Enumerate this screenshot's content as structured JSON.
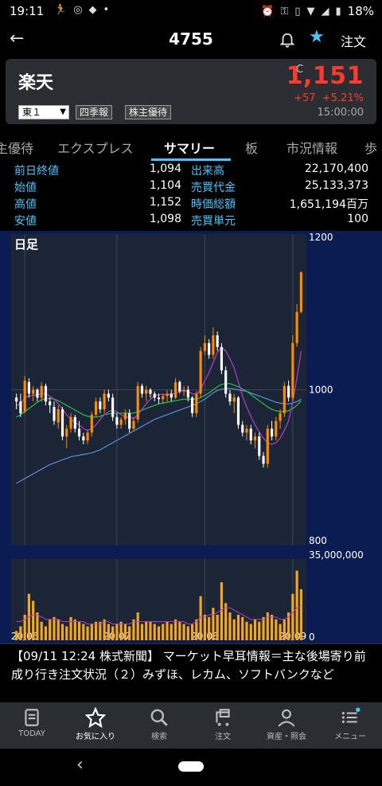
{
  "status_bar": {
    "time": "19:11",
    "battery": "18%"
  },
  "app_bar": {
    "title": "4755",
    "order_label": "注文"
  },
  "quote": {
    "name": "楽天",
    "market": "東１",
    "tag_quarterly": "四季報",
    "tag_benefit": "株主優待",
    "close_mark": "C",
    "price": "1,151",
    "change": "+57",
    "change_pct": "+5.21%",
    "time": "15:00:00"
  },
  "tabs": [
    "主優待",
    "エクスプレス",
    "サマリー",
    "板",
    "市況情報",
    "歩"
  ],
  "stats": [
    {
      "label": "前日終値",
      "value": "1,094",
      "label2": "出来高",
      "value2": "22,170,400"
    },
    {
      "label": "始値",
      "value": "1,104",
      "label2": "売買代金",
      "value2": "25,133,373"
    },
    {
      "label": "高値",
      "value": "1,152",
      "label2": "時価総額",
      "value2": "1,651,194百万"
    },
    {
      "label": "安値",
      "value": "1,098",
      "label2": "売買単元",
      "value2": "100"
    }
  ],
  "chart_data": {
    "type": "candlestick",
    "period_label": "日足",
    "price_axis": {
      "ticks": [
        "1200",
        "1000",
        "800"
      ],
      "ylim": [
        800,
        1200
      ]
    },
    "volume_axis": {
      "ticks": [
        "35,000,000",
        "0"
      ],
      "ylim": [
        0,
        35000000
      ]
    },
    "x_ticks": [
      "20/06",
      "20/07",
      "20/08",
      "20/09"
    ],
    "candles": [
      [
        990,
        995,
        975,
        985
      ],
      [
        985,
        995,
        965,
        970
      ],
      [
        972,
        1018,
        970,
        1012
      ],
      [
        1010,
        1015,
        990,
        995
      ],
      [
        995,
        1005,
        985,
        1000
      ],
      [
        1000,
        1002,
        985,
        990
      ],
      [
        990,
        1010,
        985,
        1005
      ],
      [
        1005,
        1008,
        980,
        985
      ],
      [
        985,
        990,
        970,
        980
      ],
      [
        978,
        985,
        955,
        960
      ],
      [
        958,
        980,
        950,
        975
      ],
      [
        975,
        978,
        935,
        940
      ],
      [
        940,
        955,
        925,
        950
      ],
      [
        950,
        970,
        945,
        965
      ],
      [
        965,
        968,
        945,
        950
      ],
      [
        950,
        960,
        935,
        940
      ],
      [
        940,
        945,
        930,
        935
      ],
      [
        935,
        948,
        930,
        945
      ],
      [
        945,
        972,
        940,
        968
      ],
      [
        968,
        990,
        965,
        985
      ],
      [
        985,
        990,
        970,
        975
      ],
      [
        975,
        1000,
        970,
        995
      ],
      [
        995,
        1000,
        985,
        990
      ],
      [
        990,
        995,
        960,
        965
      ],
      [
        965,
        970,
        950,
        955
      ],
      [
        955,
        965,
        950,
        962
      ],
      [
        962,
        975,
        955,
        970
      ],
      [
        970,
        975,
        945,
        950
      ],
      [
        950,
        965,
        948,
        960
      ],
      [
        962,
        1010,
        958,
        1005
      ],
      [
        1005,
        1008,
        990,
        995
      ],
      [
        995,
        1005,
        985,
        1000
      ],
      [
        1000,
        1002,
        990,
        995
      ],
      [
        995,
        998,
        985,
        990
      ],
      [
        990,
        995,
        982,
        988
      ],
      [
        988,
        995,
        982,
        992
      ],
      [
        992,
        1000,
        985,
        995
      ],
      [
        995,
        1000,
        985,
        990
      ],
      [
        990,
        1015,
        988,
        1010
      ],
      [
        1010,
        1012,
        995,
        998
      ],
      [
        998,
        1005,
        992,
        1000
      ],
      [
        1000,
        1005,
        985,
        990
      ],
      [
        990,
        992,
        965,
        970
      ],
      [
        970,
        998,
        965,
        995
      ],
      [
        995,
        1055,
        990,
        1050
      ],
      [
        1050,
        1070,
        1045,
        1060
      ],
      [
        1060,
        1065,
        1040,
        1045
      ],
      [
        1045,
        1080,
        1040,
        1070
      ],
      [
        1070,
        1075,
        1050,
        1055
      ],
      [
        1055,
        1060,
        1020,
        1025
      ],
      [
        1025,
        1030,
        990,
        995
      ],
      [
        995,
        1000,
        980,
        985
      ],
      [
        985,
        995,
        970,
        990
      ],
      [
        990,
        992,
        950,
        955
      ],
      [
        955,
        960,
        940,
        945
      ],
      [
        945,
        955,
        935,
        950
      ],
      [
        950,
        955,
        930,
        935
      ],
      [
        935,
        945,
        925,
        940
      ],
      [
        940,
        945,
        910,
        915
      ],
      [
        915,
        920,
        900,
        905
      ],
      [
        905,
        955,
        900,
        950
      ],
      [
        950,
        960,
        935,
        940
      ],
      [
        940,
        965,
        935,
        960
      ],
      [
        960,
        975,
        950,
        970
      ],
      [
        970,
        1010,
        965,
        1005
      ],
      [
        1005,
        1012,
        985,
        990
      ],
      [
        990,
        1070,
        985,
        1060
      ],
      [
        1060,
        1110,
        1055,
        1100
      ],
      [
        1100,
        1152,
        1098,
        1151
      ]
    ],
    "ma_short": [
      980,
      982,
      990,
      992,
      993,
      994,
      995,
      995,
      992,
      988,
      982,
      975,
      968,
      962,
      958,
      955,
      950,
      948,
      950,
      955,
      962,
      968,
      972,
      974,
      972,
      968,
      965,
      965,
      963,
      968,
      975,
      982,
      988,
      992,
      994,
      994,
      994,
      994,
      996,
      998,
      999,
      998,
      995,
      994,
      1000,
      1012,
      1022,
      1035,
      1048,
      1055,
      1050,
      1040,
      1028,
      1010,
      992,
      978,
      966,
      955,
      946,
      938,
      932,
      930,
      932,
      938,
      948,
      960,
      985,
      1015,
      1050
    ],
    "ma_mid": [
      965,
      968,
      972,
      976,
      980,
      984,
      987,
      989,
      989,
      988,
      986,
      983,
      980,
      977,
      974,
      971,
      968,
      966,
      965,
      965,
      966,
      968,
      969,
      970,
      970,
      970,
      970,
      970,
      970,
      972,
      974,
      976,
      978,
      980,
      982,
      983,
      984,
      985,
      986,
      987,
      988,
      988,
      988,
      988,
      990,
      993,
      996,
      1000,
      1004,
      1007,
      1008,
      1008,
      1006,
      1004,
      1001,
      998,
      994,
      990,
      986,
      982,
      978,
      975,
      973,
      972,
      972,
      973,
      976,
      980,
      986
    ],
    "ma_long": [
      880,
      883,
      886,
      889,
      892,
      895,
      898,
      901,
      904,
      906,
      908,
      910,
      912,
      914,
      915,
      916,
      917,
      918,
      919,
      921,
      923,
      926,
      929,
      932,
      935,
      938,
      941,
      944,
      947,
      950,
      953,
      956,
      959,
      962,
      964,
      966,
      968,
      970,
      972,
      974,
      976,
      978,
      980,
      982,
      985,
      988,
      992,
      996,
      999,
      1001,
      1002,
      1002,
      1001,
      1000,
      999,
      998,
      996,
      994,
      992,
      990,
      988,
      986,
      984,
      983,
      982,
      982,
      983,
      985,
      988
    ],
    "volumes": [
      4,
      6,
      11,
      20,
      17,
      12,
      8,
      6,
      9,
      10,
      9,
      7,
      6,
      10,
      9,
      8,
      7,
      6,
      7,
      8,
      8,
      9,
      7,
      6,
      7,
      8,
      7,
      6,
      9,
      12,
      7,
      8,
      8,
      7,
      6,
      7,
      8,
      7,
      9,
      8,
      7,
      6,
      7,
      9,
      19,
      11,
      10,
      14,
      11,
      25,
      16,
      12,
      9,
      11,
      10,
      8,
      7,
      9,
      8,
      10,
      12,
      11,
      9,
      7,
      9,
      12,
      20,
      30,
      22
    ],
    "vol_ma": [
      8,
      8,
      9,
      10,
      11,
      11,
      10,
      9,
      9,
      9,
      9,
      8,
      8,
      8,
      8,
      8,
      8,
      7,
      7,
      7,
      7,
      8,
      8,
      7,
      7,
      7,
      7,
      7,
      8,
      8,
      8,
      8,
      8,
      8,
      8,
      8,
      8,
      8,
      8,
      8,
      8,
      7,
      7,
      8,
      10,
      10,
      11,
      11,
      12,
      13,
      14,
      14,
      13,
      12,
      11,
      10,
      9,
      9,
      9,
      9,
      10,
      10,
      10,
      9,
      9,
      10,
      12,
      14,
      15
    ]
  },
  "news": "【09/11 12:24 株式新聞】 マーケット早耳情報＝主な後場寄り前成り行き注文状況（２）みずほ、レカム、ソフトバンクなど",
  "bottom_nav": [
    {
      "label": "TODAY",
      "icon": "document-icon"
    },
    {
      "label": "お気に入り",
      "icon": "star-icon"
    },
    {
      "label": "検索",
      "icon": "search-icon"
    },
    {
      "label": "注文",
      "icon": "cart-icon"
    },
    {
      "label": "資産・照会",
      "icon": "person-icon"
    },
    {
      "label": "メニュー",
      "icon": "menu-icon"
    }
  ],
  "colors": {
    "accent": "#4fc3f7",
    "up": "#ff3b30",
    "candle_up": "#ff8c00",
    "candle_down": "#ffffff",
    "chart_bg": "#0b1c52"
  }
}
